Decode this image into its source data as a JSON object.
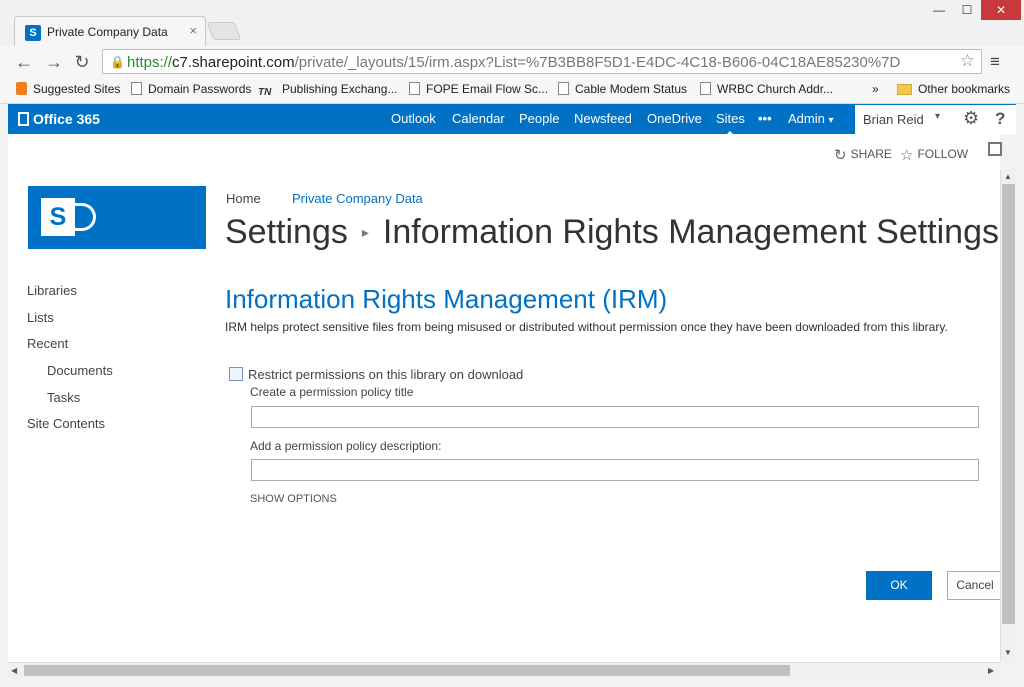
{
  "browser": {
    "tab_favicon": "S",
    "tab_title": "Private Company Data",
    "tab_close": "×",
    "window_minimize": "—",
    "window_maximize": "☐",
    "window_close": "✕",
    "back": "←",
    "forward": "→",
    "reload": "↻",
    "url_protocol": "https://",
    "url_host": "c7.sharepoint.com",
    "url_path": "/private/_layouts/15/irm.aspx?List=%7B3BB8F5D1-E4DC-4C18-B606-04C18AE85230%7D",
    "bookmark_star": "☆",
    "menu": "≡",
    "bookmarks": [
      {
        "label": "Suggested Sites",
        "icon": "orange-bookmark-icon"
      },
      {
        "label": "Domain Passwords",
        "icon": "page-icon"
      },
      {
        "label": "Publishing Exchang...",
        "icon": "tn-icon"
      },
      {
        "label": "FOPE Email Flow Sc...",
        "icon": "page-icon"
      },
      {
        "label": "Cable Modem Status",
        "icon": "page-icon"
      },
      {
        "label": "WRBC Church Addr...",
        "icon": "page-icon"
      }
    ],
    "bookmarks_more": "»",
    "other_bookmarks": "Other bookmarks",
    "tn_icon_text": "TN"
  },
  "suitebar": {
    "brand": "Office 365",
    "links": [
      "Outlook",
      "Calendar",
      "People",
      "Newsfeed",
      "OneDrive",
      "Sites",
      "•••",
      "Admin"
    ],
    "active_link": "Sites",
    "admin_caret": "▾",
    "user_name": "Brian Reid",
    "user_caret": "▾",
    "settings": "⚙",
    "help": "?",
    "color": "#0072c6"
  },
  "ribbon": {
    "share_icon": "↻",
    "share": "SHARE",
    "follow_icon": "☆",
    "follow": "FOLLOW"
  },
  "logo": {
    "letter": "S"
  },
  "breadcrumb": {
    "home": "Home",
    "site": "Private Company Data"
  },
  "title": {
    "parent": "Settings",
    "separator": "▸",
    "current": "Information Rights Management Settings"
  },
  "leftnav": {
    "items": [
      {
        "label": "Libraries"
      },
      {
        "label": "Lists"
      },
      {
        "label": "Recent"
      },
      {
        "label": "Documents"
      },
      {
        "label": "Tasks"
      },
      {
        "label": "Site Contents"
      }
    ]
  },
  "irm": {
    "heading": "Information Rights Management (IRM)",
    "description": "IRM helps protect sensitive files from being misused or distributed without permission once they have been downloaded from this library.",
    "restrict_label": "Restrict permissions on this library on download",
    "restrict_checked": false,
    "title_label": "Create a permission policy title",
    "title_value": "",
    "desc_label": "Add a permission policy description:",
    "desc_value": "",
    "show_options": "SHOW OPTIONS",
    "ok": "OK",
    "cancel": "Cancel"
  },
  "scroll": {
    "up": "▲",
    "down": "▼",
    "left": "◀",
    "right": "▶"
  }
}
